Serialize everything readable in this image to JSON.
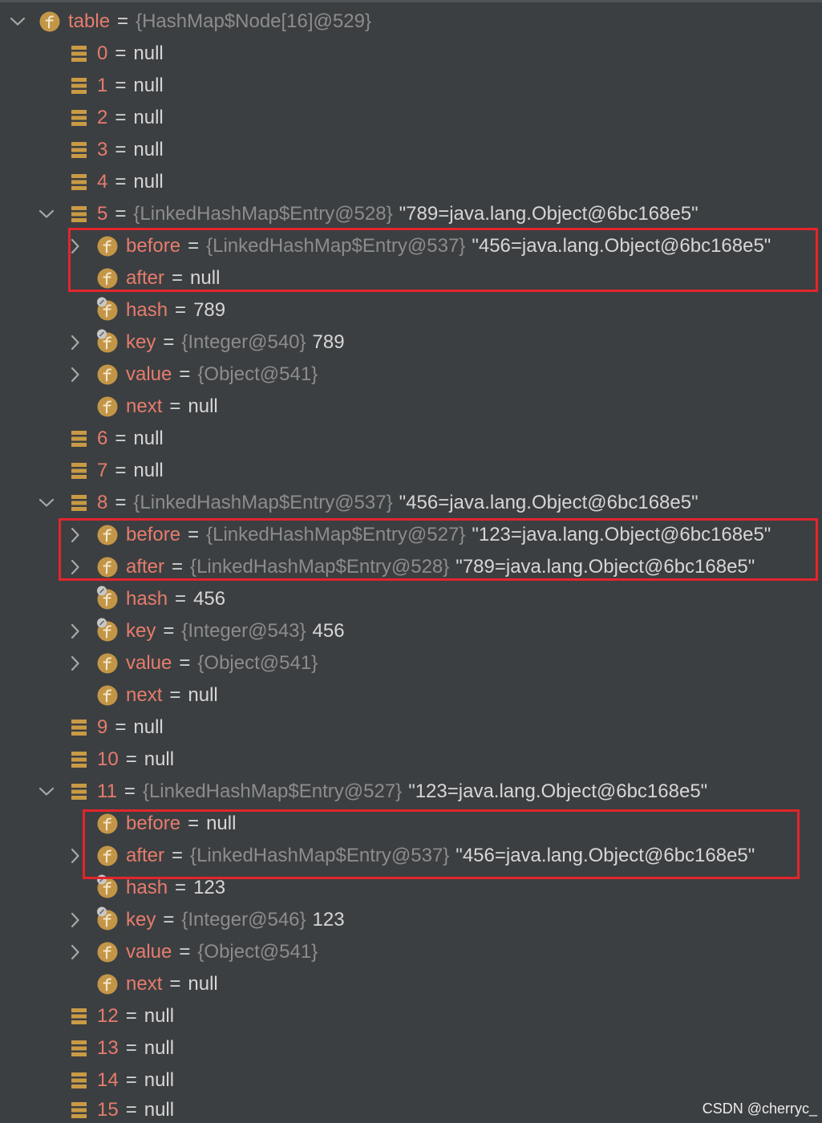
{
  "separator": "=",
  "watermark": "CSDN @cherryc_",
  "colors": {
    "background": "#3c3f41",
    "variable_name": "#e67c6d",
    "plain_text": "#d6d6d6",
    "type_text": "#8c8c8c",
    "field_icon": "#c39647",
    "field_icon_letter": "#f4e7cc",
    "array_icon": "#c99a45",
    "badge": "#c8c8c8",
    "chevron": "#a8a8a8",
    "highlight_box": "#e3252d"
  },
  "tree": [
    {
      "name": "table",
      "type": "{HashMap$Node[16]@529}",
      "icon": "field-icon",
      "expanded": true,
      "children": [
        {
          "name": "0",
          "value": "null",
          "icon": "array-element-icon"
        },
        {
          "name": "1",
          "value": "null",
          "icon": "array-element-icon"
        },
        {
          "name": "2",
          "value": "null",
          "icon": "array-element-icon"
        },
        {
          "name": "3",
          "value": "null",
          "icon": "array-element-icon"
        },
        {
          "name": "4",
          "value": "null",
          "icon": "array-element-icon"
        },
        {
          "name": "5",
          "type": "{LinkedHashMap$Entry@528}",
          "value": "\"789=java.lang.Object@6bc168e5\"",
          "icon": "array-element-icon",
          "expanded": true,
          "children": [
            {
              "name": "before",
              "type": "{LinkedHashMap$Entry@537}",
              "value": "\"456=java.lang.Object@6bc168e5\"",
              "icon": "field-icon",
              "expanded": false,
              "highlight": true
            },
            {
              "name": "after",
              "value": "null",
              "icon": "field-icon",
              "highlight": true
            },
            {
              "name": "hash",
              "value": "789",
              "icon": "field-icon",
              "badge": "final-badge-icon"
            },
            {
              "name": "key",
              "type": "{Integer@540}",
              "value": "789",
              "icon": "field-icon",
              "badge": "final-badge-icon",
              "expanded": false
            },
            {
              "name": "value",
              "type": "{Object@541}",
              "icon": "field-icon",
              "expanded": false
            },
            {
              "name": "next",
              "value": "null",
              "icon": "field-icon"
            }
          ]
        },
        {
          "name": "6",
          "value": "null",
          "icon": "array-element-icon"
        },
        {
          "name": "7",
          "value": "null",
          "icon": "array-element-icon"
        },
        {
          "name": "8",
          "type": "{LinkedHashMap$Entry@537}",
          "value": "\"456=java.lang.Object@6bc168e5\"",
          "icon": "array-element-icon",
          "expanded": true,
          "children": [
            {
              "name": "before",
              "type": "{LinkedHashMap$Entry@527}",
              "value": "\"123=java.lang.Object@6bc168e5\"",
              "icon": "field-icon",
              "expanded": false,
              "highlight": true
            },
            {
              "name": "after",
              "type": "{LinkedHashMap$Entry@528}",
              "value": "\"789=java.lang.Object@6bc168e5\"",
              "icon": "field-icon",
              "expanded": false,
              "highlight": true
            },
            {
              "name": "hash",
              "value": "456",
              "icon": "field-icon",
              "badge": "final-badge-icon"
            },
            {
              "name": "key",
              "type": "{Integer@543}",
              "value": "456",
              "icon": "field-icon",
              "badge": "final-badge-icon",
              "expanded": false
            },
            {
              "name": "value",
              "type": "{Object@541}",
              "icon": "field-icon",
              "expanded": false
            },
            {
              "name": "next",
              "value": "null",
              "icon": "field-icon"
            }
          ]
        },
        {
          "name": "9",
          "value": "null",
          "icon": "array-element-icon"
        },
        {
          "name": "10",
          "value": "null",
          "icon": "array-element-icon"
        },
        {
          "name": "11",
          "type": "{LinkedHashMap$Entry@527}",
          "value": "\"123=java.lang.Object@6bc168e5\"",
          "icon": "array-element-icon",
          "expanded": true,
          "children": [
            {
              "name": "before",
              "value": "null",
              "icon": "field-icon",
              "highlight": true
            },
            {
              "name": "after",
              "type": "{LinkedHashMap$Entry@537}",
              "value": "\"456=java.lang.Object@6bc168e5\"",
              "icon": "field-icon",
              "expanded": false,
              "highlight": true
            },
            {
              "name": "hash",
              "value": "123",
              "icon": "field-icon",
              "badge": "final-badge-icon"
            },
            {
              "name": "key",
              "type": "{Integer@546}",
              "value": "123",
              "icon": "field-icon",
              "badge": "final-badge-icon",
              "expanded": false
            },
            {
              "name": "value",
              "type": "{Object@541}",
              "icon": "field-icon",
              "expanded": false
            },
            {
              "name": "next",
              "value": "null",
              "icon": "field-icon"
            }
          ]
        },
        {
          "name": "12",
          "value": "null",
          "icon": "array-element-icon"
        },
        {
          "name": "13",
          "value": "null",
          "icon": "array-element-icon"
        },
        {
          "name": "14",
          "value": "null",
          "icon": "array-element-icon"
        },
        {
          "name": "15",
          "value": "null",
          "icon": "array-element-icon"
        }
      ]
    }
  ]
}
